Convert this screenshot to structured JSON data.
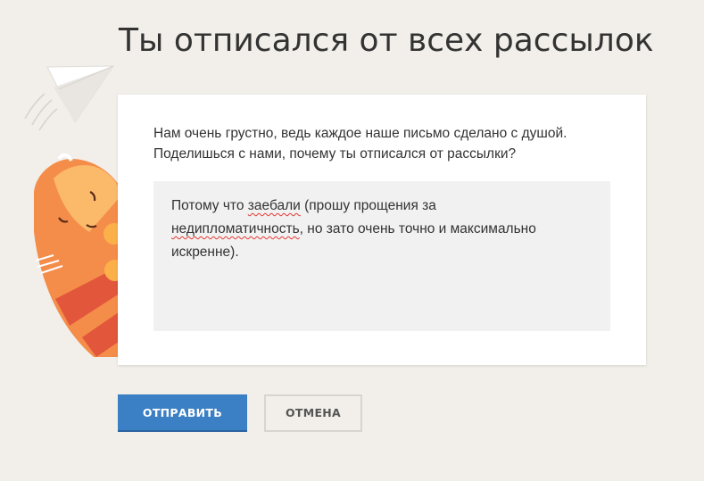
{
  "header": {
    "title": "Ты отписался от всех рассылок"
  },
  "form": {
    "prompt_line1": "Нам очень грустно, ведь каждое наше письмо сделано с душой.",
    "prompt_line2": "Поделишься с нами, почему ты отписался от рассылки?",
    "feedback": {
      "line1_before": "Потому что ",
      "line1_misspelled": "заебали",
      "line1_after": " (прошу прощения за",
      "line2_misspelled": "недипломатичность",
      "line2_after": ", но зато очень точно и максимально",
      "line3": "искренне)."
    }
  },
  "actions": {
    "submit_label": "ОТПРАВИТЬ",
    "cancel_label": "ОТМЕНА"
  },
  "colors": {
    "background": "#f2efea",
    "primary_button": "#3b7fc4",
    "illustration_orange": "#f5874a",
    "illustration_stripe": "#e0523a",
    "paw": "#fbb04a"
  },
  "illustration": {
    "elements": [
      "paper-plane-icon",
      "cat-illustration"
    ]
  }
}
